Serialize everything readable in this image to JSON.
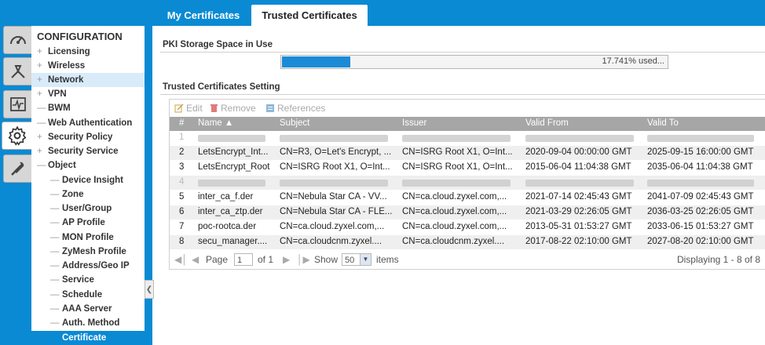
{
  "tabs": [
    {
      "label": "My Certificates",
      "active": false
    },
    {
      "label": "Trusted Certificates",
      "active": true
    }
  ],
  "rail_icons": [
    "dashboard-icon",
    "monitor-tools-icon",
    "pulse-icon",
    "gear-icon",
    "wrench-icon"
  ],
  "nav": {
    "title": "CONFIGURATION",
    "items": [
      {
        "sym": "+",
        "label": "Licensing"
      },
      {
        "sym": "+",
        "label": "Wireless"
      },
      {
        "sym": "+",
        "label": "Network"
      },
      {
        "sym": "+",
        "label": "VPN"
      },
      {
        "sym": "—",
        "label": "BWM"
      },
      {
        "sym": "—",
        "label": "Web Authentication"
      },
      {
        "sym": "+",
        "label": "Security Policy"
      },
      {
        "sym": "+",
        "label": "Security Service"
      },
      {
        "sym": "—",
        "label": "Object"
      }
    ],
    "sub_items": [
      {
        "sym": "—",
        "label": "Device Insight"
      },
      {
        "sym": "—",
        "label": "Zone"
      },
      {
        "sym": "—",
        "label": "User/Group"
      },
      {
        "sym": "—",
        "label": "AP Profile"
      },
      {
        "sym": "—",
        "label": "MON Profile"
      },
      {
        "sym": "—",
        "label": "ZyMesh Profile"
      },
      {
        "sym": "—",
        "label": "Address/Geo IP"
      },
      {
        "sym": "—",
        "label": "Service"
      },
      {
        "sym": "—",
        "label": "Schedule"
      },
      {
        "sym": "—",
        "label": "AAA Server"
      },
      {
        "sym": "—",
        "label": "Auth. Method"
      },
      {
        "sym": "",
        "label": "Certificate"
      }
    ]
  },
  "storage": {
    "title": "PKI Storage Space in Use",
    "used_text": "17.741% used...",
    "used_fraction": 0.177
  },
  "settings": {
    "title": "Trusted Certificates Setting",
    "toolbar": {
      "edit": "Edit",
      "remove": "Remove",
      "references": "References"
    },
    "columns": {
      "num": "#",
      "name": "Name ▲",
      "subject": "Subject",
      "issuer": "Issuer",
      "valid_from": "Valid From",
      "valid_to": "Valid To"
    },
    "rows": [
      {
        "num": "1",
        "name": "",
        "subject": "",
        "issuer": "",
        "valid_from": "",
        "valid_to": "",
        "blurred": true
      },
      {
        "num": "2",
        "name": "LetsEncrypt_Int...",
        "subject": "CN=R3, O=Let's Encrypt, ...",
        "issuer": "CN=ISRG Root X1, O=Int...",
        "valid_from": "2020-09-04 00:00:00 GMT",
        "valid_to": "2025-09-15 16:00:00 GMT",
        "blurred": false
      },
      {
        "num": "3",
        "name": "LetsEncrypt_Root",
        "subject": "CN=ISRG Root X1, O=Int...",
        "issuer": "CN=ISRG Root X1, O=Int...",
        "valid_from": "2015-06-04 11:04:38 GMT",
        "valid_to": "2035-06-04 11:04:38 GMT",
        "blurred": false
      },
      {
        "num": "4",
        "name": "",
        "subject": "",
        "issuer": "",
        "valid_from": "",
        "valid_to": "",
        "blurred": true
      },
      {
        "num": "5",
        "name": "inter_ca_f.der",
        "subject": "CN=Nebula Star CA - VV...",
        "issuer": "CN=ca.cloud.zyxel.com,...",
        "valid_from": "2021-07-14 02:45:43 GMT",
        "valid_to": "2041-07-09 02:45:43 GMT",
        "blurred": false
      },
      {
        "num": "6",
        "name": "inter_ca_ztp.der",
        "subject": "CN=Nebula Star CA - FLE...",
        "issuer": "CN=ca.cloud.zyxel.com,...",
        "valid_from": "2021-03-29 02:26:05 GMT",
        "valid_to": "2036-03-25 02:26:05 GMT",
        "blurred": false
      },
      {
        "num": "7",
        "name": "poc-rootca.der",
        "subject": "CN=ca.cloud.zyxel.com,...",
        "issuer": "CN=ca.cloud.zyxel.com,...",
        "valid_from": "2013-05-31 01:53:27 GMT",
        "valid_to": "2033-06-15 01:53:27 GMT",
        "blurred": false
      },
      {
        "num": "8",
        "name": "secu_manager....",
        "subject": "CN=ca.cloudcnm.zyxel....",
        "issuer": "CN=ca.cloudcnm.zyxel....",
        "valid_from": "2017-08-22 02:10:00 GMT",
        "valid_to": "2027-08-20 02:10:00 GMT",
        "blurred": false
      }
    ],
    "pager": {
      "page_label": "Page",
      "page_value": "1",
      "of_text": "of 1",
      "show_label": "Show",
      "per_page": "50",
      "items_label": "items",
      "displaying": "Displaying 1 - 8 of 8"
    }
  }
}
